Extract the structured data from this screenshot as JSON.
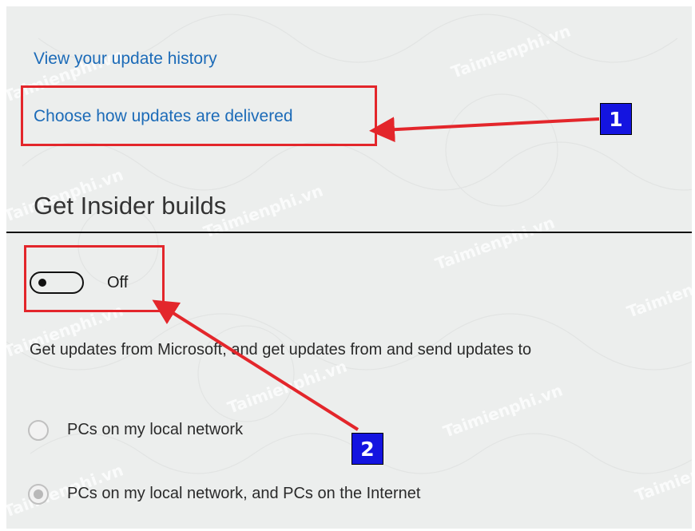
{
  "links": {
    "history": "View your update history",
    "delivered": "Choose how updates are delivered"
  },
  "insider": {
    "heading": "Get Insider builds",
    "toggle_state": "Off"
  },
  "delivery": {
    "description": "Get updates from Microsoft, and get updates from and send updates to",
    "options": [
      {
        "label": "PCs on my local network",
        "selected": false
      },
      {
        "label": "PCs on my local network, and PCs on the Internet",
        "selected": true
      }
    ]
  },
  "annotations": {
    "badge1": "1",
    "badge2": "2",
    "color": "#e3262b",
    "badge_color": "#1414e0"
  },
  "watermark": "Taimienphi.vn"
}
